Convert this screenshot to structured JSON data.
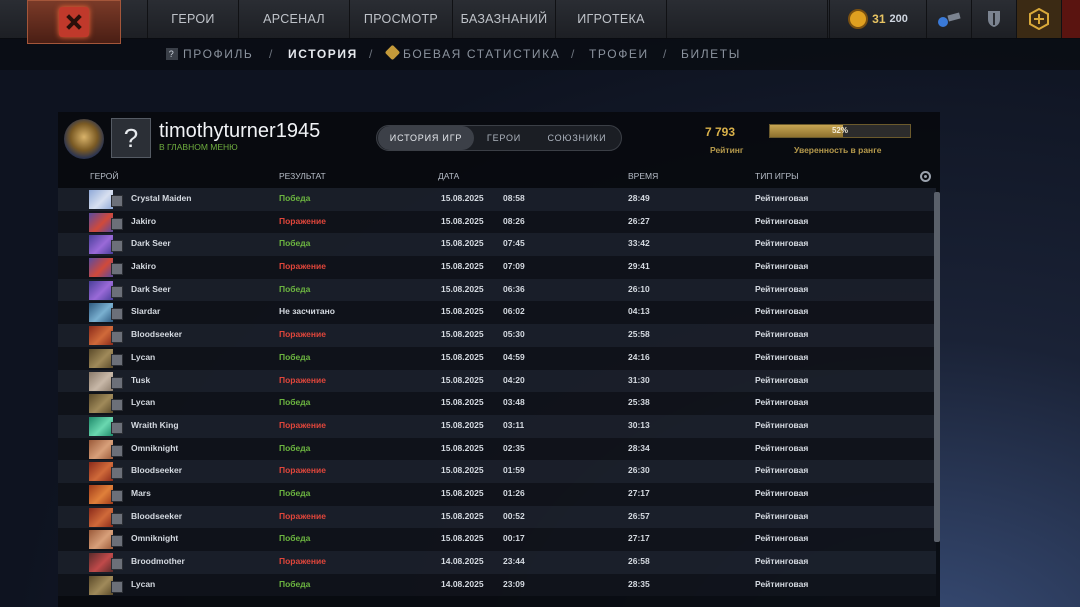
{
  "topnav": {
    "tabs": [
      "ГЕРОИ",
      "АРСЕНАЛ",
      "ПРОСМОТР",
      "БАЗАЗНАНИЙ",
      "ИГРОТЕКА"
    ],
    "coins": "31",
    "level_text": "200"
  },
  "subnav": {
    "profile": "ПРОФИЛЬ",
    "history": "ИСТОРИЯ",
    "combat_stats": "БОЕВАЯ СТАТИСТИКА",
    "trophies": "ТРОФЕИ",
    "tickets": "БИЛЕТЫ",
    "separator": "/"
  },
  "profile": {
    "avatar_text": "?",
    "username": "timothyturner1945",
    "status": "В ГЛАВНОМ МЕНЮ",
    "tabs": [
      "ИСТОРИЯ ИГР",
      "ГЕРОИ",
      "СОЮЗНИКИ"
    ],
    "rating_value": "7 793",
    "rating_label": "Рейтинг",
    "confidence": 0.52,
    "confidence_text": "52%",
    "confidence_label": "Уверенность в ранге"
  },
  "columns": {
    "hero": "ГЕРОЙ",
    "result": "РЕЗУЛЬТАТ",
    "date": "ДАТА",
    "time": "ВРЕМЯ",
    "type": "ТИП ИГРЫ"
  },
  "colors": {
    "win": "#6cb540",
    "loss": "#e0463b",
    "gold": "#d9b14a"
  },
  "matches": [
    {
      "hero": "Crystal Maiden",
      "result": "Победа",
      "kind": "win",
      "date": "15.08.2025",
      "clock": "08:58",
      "duration": "28:49",
      "type": "Рейтинговая",
      "c1": "#8fa9d8",
      "c2": "#d8e0f0"
    },
    {
      "hero": "Jakiro",
      "result": "Поражение",
      "kind": "loss",
      "date": "15.08.2025",
      "clock": "08:26",
      "duration": "26:27",
      "type": "Рейтинговая",
      "c1": "#5a4ba0",
      "c2": "#d04a3a"
    },
    {
      "hero": "Dark Seer",
      "result": "Победа",
      "kind": "win",
      "date": "15.08.2025",
      "clock": "07:45",
      "duration": "33:42",
      "type": "Рейтинговая",
      "c1": "#4a3f9a",
      "c2": "#9a6ad8"
    },
    {
      "hero": "Jakiro",
      "result": "Поражение",
      "kind": "loss",
      "date": "15.08.2025",
      "clock": "07:09",
      "duration": "29:41",
      "type": "Рейтинговая",
      "c1": "#5a4ba0",
      "c2": "#d04a3a"
    },
    {
      "hero": "Dark Seer",
      "result": "Победа",
      "kind": "win",
      "date": "15.08.2025",
      "clock": "06:36",
      "duration": "26:10",
      "type": "Рейтинговая",
      "c1": "#4a3f9a",
      "c2": "#9a6ad8"
    },
    {
      "hero": "Slardar",
      "result": "Не засчитано",
      "kind": "neutral",
      "date": "15.08.2025",
      "clock": "06:02",
      "duration": "04:13",
      "type": "Рейтинговая",
      "c1": "#2e5a80",
      "c2": "#7ab0d0"
    },
    {
      "hero": "Bloodseeker",
      "result": "Поражение",
      "kind": "loss",
      "date": "15.08.2025",
      "clock": "05:30",
      "duration": "25:58",
      "type": "Рейтинговая",
      "c1": "#8a2a1a",
      "c2": "#d06a3a"
    },
    {
      "hero": "Lycan",
      "result": "Победа",
      "kind": "win",
      "date": "15.08.2025",
      "clock": "04:59",
      "duration": "24:16",
      "type": "Рейтинговая",
      "c1": "#5a4a2a",
      "c2": "#a08a5a"
    },
    {
      "hero": "Tusk",
      "result": "Поражение",
      "kind": "loss",
      "date": "15.08.2025",
      "clock": "04:20",
      "duration": "31:30",
      "type": "Рейтинговая",
      "c1": "#8a7a6a",
      "c2": "#c8b8a8"
    },
    {
      "hero": "Lycan",
      "result": "Победа",
      "kind": "win",
      "date": "15.08.2025",
      "clock": "03:48",
      "duration": "25:38",
      "type": "Рейтинговая",
      "c1": "#5a4a2a",
      "c2": "#a08a5a"
    },
    {
      "hero": "Wraith King",
      "result": "Поражение",
      "kind": "loss",
      "date": "15.08.2025",
      "clock": "03:11",
      "duration": "30:13",
      "type": "Рейтинговая",
      "c1": "#1f8a6a",
      "c2": "#6ad8b0"
    },
    {
      "hero": "Omniknight",
      "result": "Победа",
      "kind": "win",
      "date": "15.08.2025",
      "clock": "02:35",
      "duration": "28:34",
      "type": "Рейтинговая",
      "c1": "#9a5a3a",
      "c2": "#d8a07a"
    },
    {
      "hero": "Bloodseeker",
      "result": "Поражение",
      "kind": "loss",
      "date": "15.08.2025",
      "clock": "01:59",
      "duration": "26:30",
      "type": "Рейтинговая",
      "c1": "#8a2a1a",
      "c2": "#d06a3a"
    },
    {
      "hero": "Mars",
      "result": "Победа",
      "kind": "win",
      "date": "15.08.2025",
      "clock": "01:26",
      "duration": "27:17",
      "type": "Рейтинговая",
      "c1": "#a03a1a",
      "c2": "#e0803a"
    },
    {
      "hero": "Bloodseeker",
      "result": "Поражение",
      "kind": "loss",
      "date": "15.08.2025",
      "clock": "00:52",
      "duration": "26:57",
      "type": "Рейтинговая",
      "c1": "#8a2a1a",
      "c2": "#d06a3a"
    },
    {
      "hero": "Omniknight",
      "result": "Победа",
      "kind": "win",
      "date": "15.08.2025",
      "clock": "00:17",
      "duration": "27:17",
      "type": "Рейтинговая",
      "c1": "#9a5a3a",
      "c2": "#d8a07a"
    },
    {
      "hero": "Broodmother",
      "result": "Поражение",
      "kind": "loss",
      "date": "14.08.2025",
      "clock": "23:44",
      "duration": "26:58",
      "type": "Рейтинговая",
      "c1": "#5a2a2a",
      "c2": "#c04a4a"
    },
    {
      "hero": "Lycan",
      "result": "Победа",
      "kind": "win",
      "date": "14.08.2025",
      "clock": "23:09",
      "duration": "28:35",
      "type": "Рейтинговая",
      "c1": "#5a4a2a",
      "c2": "#a08a5a"
    }
  ]
}
